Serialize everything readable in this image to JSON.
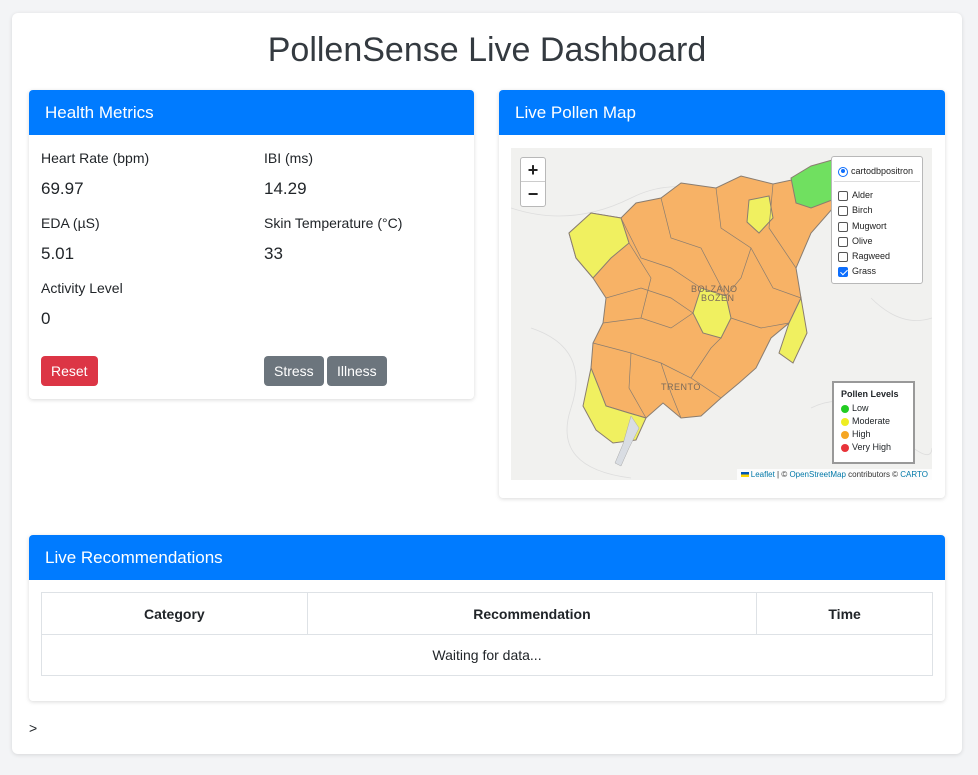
{
  "page": {
    "title": "PollenSense Live Dashboard",
    "footer_prompt": ">"
  },
  "health": {
    "header": "Health Metrics",
    "metrics": [
      {
        "label": "Heart Rate (bpm)",
        "value": "69.97"
      },
      {
        "label": "IBI (ms)",
        "value": "14.29"
      },
      {
        "label": "EDA (µS)",
        "value": "5.01"
      },
      {
        "label": "Skin Temperature (°C)",
        "value": "33"
      },
      {
        "label": "Activity Level",
        "value": "0"
      }
    ],
    "buttons": {
      "reset": "Reset",
      "stress": "Stress",
      "illness": "Illness"
    }
  },
  "map": {
    "header": "Live Pollen Map",
    "zoom_in": "+",
    "zoom_out": "−",
    "base_layer": "cartodbpositron",
    "overlays": [
      {
        "label": "Alder",
        "checked": false
      },
      {
        "label": "Birch",
        "checked": false
      },
      {
        "label": "Mugwort",
        "checked": false
      },
      {
        "label": "Olive",
        "checked": false
      },
      {
        "label": "Ragweed",
        "checked": false
      },
      {
        "label": "Grass",
        "checked": true
      }
    ],
    "place_labels": {
      "bolzano": "BOLZANO",
      "bozen": "BOZEN",
      "trento": "TRENTO"
    },
    "legend": {
      "title": "Pollen Levels",
      "items": [
        {
          "label": "Low",
          "color": "#22cc22"
        },
        {
          "label": "Moderate",
          "color": "#eeee22"
        },
        {
          "label": "High",
          "color": "#f5a623"
        },
        {
          "label": "Very High",
          "color": "#e8333a"
        }
      ]
    },
    "attribution": {
      "leaflet": "Leaflet",
      "sep1": " | © ",
      "osm": "OpenStreetMap",
      "mid": " contributors © ",
      "carto": "CARTO"
    },
    "colors": {
      "high": "#f7b266",
      "moderate": "#f0f060",
      "low": "#70e060",
      "border": "#888888"
    }
  },
  "recommendations": {
    "header": "Live Recommendations",
    "columns": [
      "Category",
      "Recommendation",
      "Time"
    ],
    "empty_text": "Waiting for data..."
  }
}
